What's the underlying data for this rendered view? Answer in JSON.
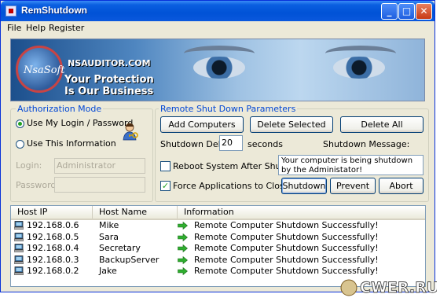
{
  "window": {
    "title": "RemShutdown",
    "minimize": "_",
    "maximize": "□",
    "close": "✕"
  },
  "menu": [
    "File",
    "Help",
    "Register"
  ],
  "banner": {
    "logo_text": "NsaSoft",
    "site": "NSAUDITOR.COM",
    "slogan": "Your Protection\nIs Our Business"
  },
  "auth": {
    "legend": "Authorization Mode",
    "option_mylogin": "Use My Login / Password",
    "option_this": "Use This Information",
    "selected": "option_mylogin",
    "login_label": "Login:",
    "login_value": "Administrator",
    "password_label": "Password:",
    "password_value": ""
  },
  "params": {
    "legend": "Remote Shut Down Parameters",
    "add_computers": "Add Computers",
    "delete_selected": "Delete Selected",
    "delete_all": "Delete All",
    "delay_label": "Shutdown Delay:",
    "delay_value": "20",
    "delay_unit": "seconds",
    "message_label": "Shutdown Message:",
    "message_value": "Your computer is being shutdown by the Administator!",
    "reboot_label": "Reboot System After Shutdown",
    "reboot_checked": false,
    "force_label": "Force Applications to Close",
    "force_checked": true,
    "shutdown_btn": "Shutdown",
    "prevent_btn": "Prevent",
    "abort_btn": "Abort"
  },
  "hosts": {
    "columns": [
      "Host IP",
      "Host Name",
      "Information"
    ],
    "rows": [
      {
        "ip": "192.168.0.6",
        "name": "Mike",
        "info": "Remote Computer Shutdown Successfully!"
      },
      {
        "ip": "192.168.0.5",
        "name": "Sara",
        "info": "Remote Computer Shutdown Successfully!"
      },
      {
        "ip": "192.168.0.4",
        "name": "Secretary",
        "info": "Remote Computer Shutdown Successfully!"
      },
      {
        "ip": "192.168.0.3",
        "name": "BackupServer",
        "info": "Remote Computer Shutdown Successfully!"
      },
      {
        "ip": "192.168.0.2",
        "name": "Jake",
        "info": "Remote Computer Shutdown Successfully!"
      }
    ]
  },
  "watermark": "CWER.RU",
  "colors": {
    "titlebar": "#0052d6",
    "legend": "#0046d5",
    "arrow": "#2fae2f"
  }
}
